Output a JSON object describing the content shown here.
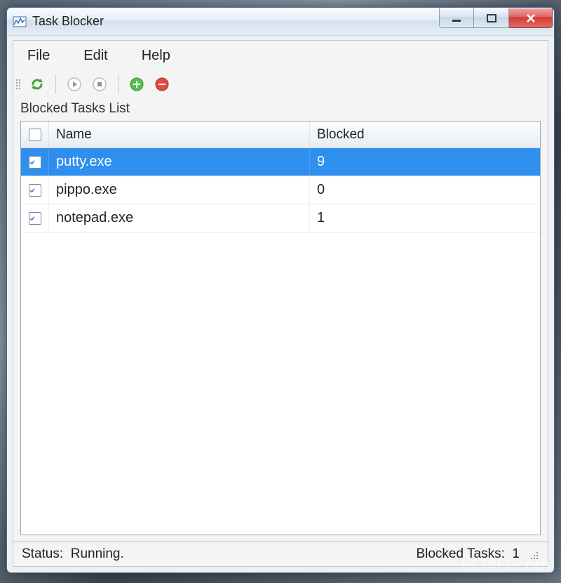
{
  "window": {
    "title": "Task Blocker"
  },
  "menu": {
    "file": "File",
    "edit": "Edit",
    "help": "Help"
  },
  "list_label": "Blocked Tasks List",
  "columns": {
    "name": "Name",
    "blocked": "Blocked"
  },
  "rows": [
    {
      "checked": true,
      "name": "putty.exe",
      "blocked": "9",
      "selected": true
    },
    {
      "checked": true,
      "name": "pippo.exe",
      "blocked": "0",
      "selected": false
    },
    {
      "checked": true,
      "name": "notepad.exe",
      "blocked": "1",
      "selected": false
    }
  ],
  "status": {
    "label": "Status:",
    "value": "Running.",
    "blocked_label": "Blocked Tasks:",
    "blocked_value": "1"
  },
  "watermark": "LO4D.com"
}
